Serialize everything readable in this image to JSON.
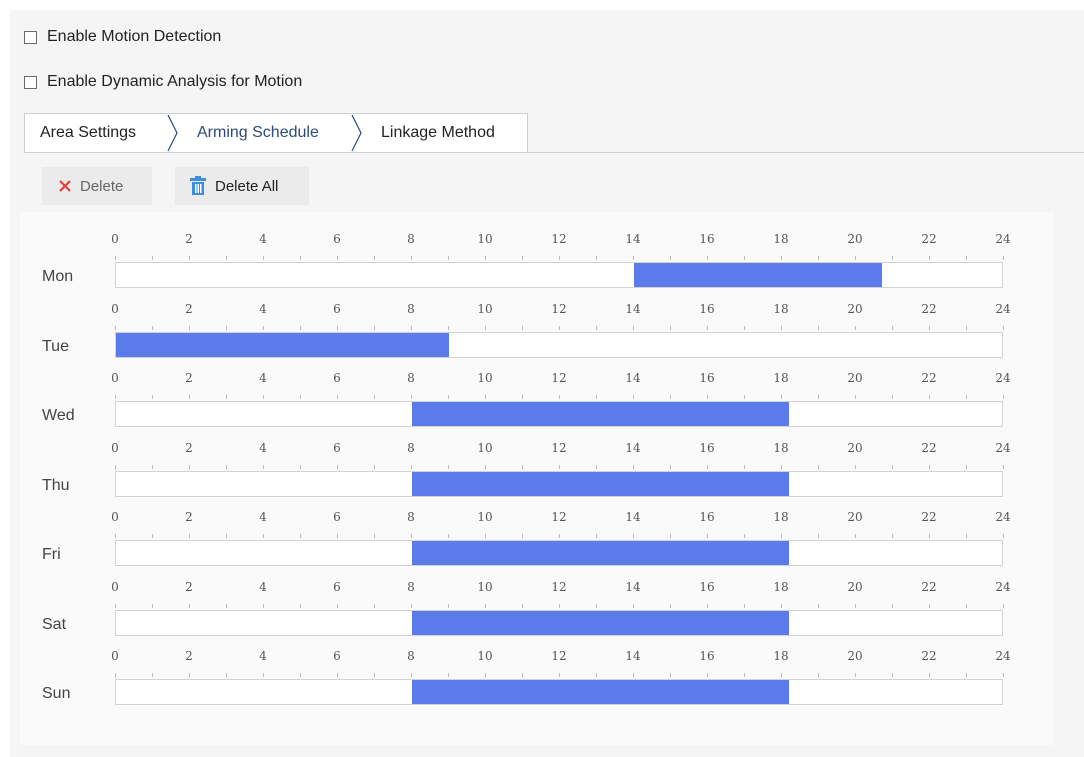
{
  "checkboxes": {
    "motion_detection": {
      "label": "Enable Motion Detection",
      "checked": false
    },
    "dynamic_analysis": {
      "label": "Enable Dynamic Analysis for Motion",
      "checked": false
    }
  },
  "tabs": [
    {
      "label": "Area Settings",
      "active": false
    },
    {
      "label": "Arming Schedule",
      "active": true
    },
    {
      "label": "Linkage Method",
      "active": false
    }
  ],
  "toolbar": {
    "delete_label": "Delete",
    "delete_all_label": "Delete All"
  },
  "colors": {
    "schedule_segment": "#5b7bea",
    "delete_icon": "#e53935",
    "trash_icon": "#3d8ee0"
  },
  "hour_ticks": [
    "0",
    "2",
    "4",
    "6",
    "8",
    "10",
    "12",
    "14",
    "16",
    "18",
    "20",
    "22",
    "24"
  ],
  "days": [
    {
      "label": "Mon",
      "segments": [
        [
          14,
          20.7
        ]
      ]
    },
    {
      "label": "Tue",
      "segments": [
        [
          0,
          9
        ]
      ]
    },
    {
      "label": "Wed",
      "segments": [
        [
          8,
          18.2
        ]
      ]
    },
    {
      "label": "Thu",
      "segments": [
        [
          8,
          18.2
        ]
      ]
    },
    {
      "label": "Fri",
      "segments": [
        [
          8,
          18.2
        ]
      ]
    },
    {
      "label": "Sat",
      "segments": [
        [
          8,
          18.2
        ]
      ]
    },
    {
      "label": "Sun",
      "segments": [
        [
          8,
          18.2
        ]
      ]
    }
  ]
}
